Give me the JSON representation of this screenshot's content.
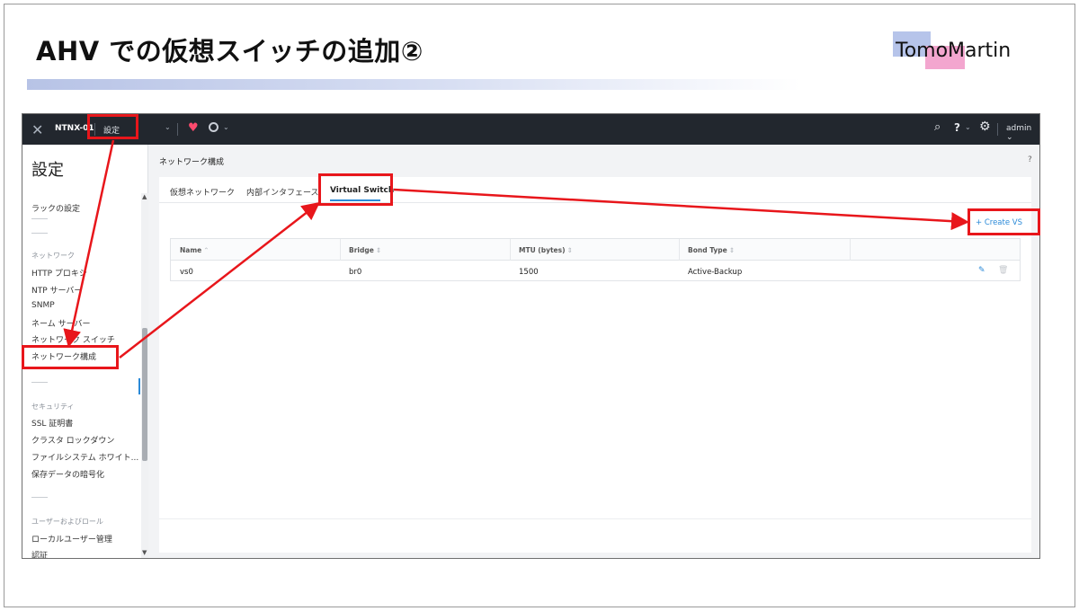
{
  "slide": {
    "title": "AHV での仮想スイッチの追加②",
    "logo_text": "TomoMartin"
  },
  "topbar": {
    "cluster_name": "NTNX-01",
    "menu_label": "設定",
    "user": "admin"
  },
  "sidebar": {
    "title": "設定",
    "items": [
      {
        "type": "item",
        "label": "ラックの設定"
      },
      {
        "type": "group",
        "label": "ネットワーク"
      },
      {
        "type": "item",
        "label": "HTTP プロキシ"
      },
      {
        "type": "item",
        "label": "NTP サーバー"
      },
      {
        "type": "item",
        "label": "SNMP"
      },
      {
        "type": "item",
        "label": "ネーム サーバー"
      },
      {
        "type": "item",
        "label": "ネットワーク スイッチ"
      },
      {
        "type": "item",
        "label": "ネットワーク構成"
      },
      {
        "type": "group",
        "label": "セキュリティ"
      },
      {
        "type": "item",
        "label": "SSL 証明書"
      },
      {
        "type": "item",
        "label": "クラスタ ロックダウン"
      },
      {
        "type": "item",
        "label": "ファイルシステム ホワイト..."
      },
      {
        "type": "item",
        "label": "保存データの暗号化"
      },
      {
        "type": "group",
        "label": "ユーザーおよびロール"
      },
      {
        "type": "item",
        "label": "ローカルユーザー管理"
      },
      {
        "type": "item",
        "label": "認証"
      }
    ]
  },
  "content": {
    "header": "ネットワーク構成",
    "help": "?",
    "tabs": [
      "仮想ネットワーク",
      "内部インタフェース",
      "Virtual Switch"
    ],
    "active_tab": "Virtual Switch",
    "create_button": "+ Create VS",
    "table": {
      "columns": [
        "Name",
        "Bridge",
        "MTU (bytes)",
        "Bond Type"
      ],
      "rows": [
        [
          "vs0",
          "br0",
          "1500",
          "Active-Backup"
        ]
      ]
    }
  },
  "colors": {
    "highlight": "#e8161b",
    "accent": "#2b8ad8",
    "topbar": "#22272e"
  }
}
